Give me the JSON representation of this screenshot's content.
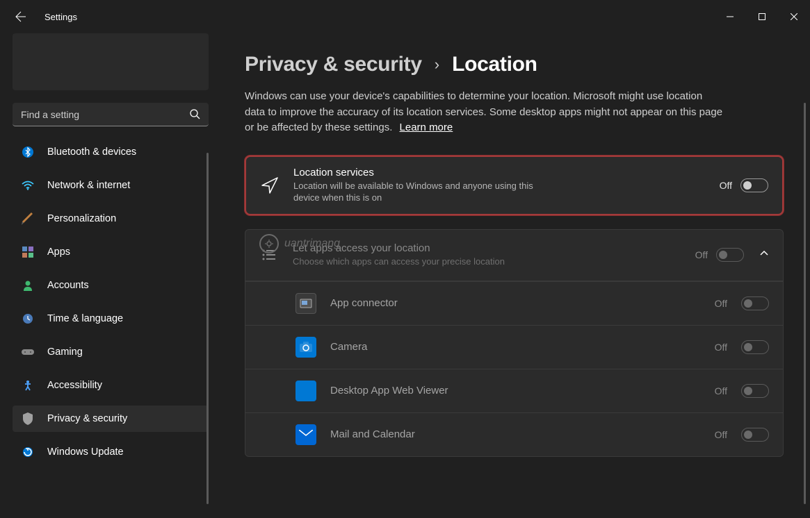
{
  "app_title": "Settings",
  "search": {
    "placeholder": "Find a setting"
  },
  "sidebar": {
    "items": [
      {
        "label": "Bluetooth & devices"
      },
      {
        "label": "Network & internet"
      },
      {
        "label": "Personalization"
      },
      {
        "label": "Apps"
      },
      {
        "label": "Accounts"
      },
      {
        "label": "Time & language"
      },
      {
        "label": "Gaming"
      },
      {
        "label": "Accessibility"
      },
      {
        "label": "Privacy & security"
      },
      {
        "label": "Windows Update"
      }
    ]
  },
  "breadcrumb": {
    "parent": "Privacy & security",
    "current": "Location"
  },
  "description": "Windows can use your device's capabilities to determine your location. Microsoft might use location data to improve the accuracy of its location services. Some desktop apps might not appear on this page or be affected by these settings.",
  "learn_more": "Learn more",
  "location_services": {
    "title": "Location services",
    "sub": "Location will be available to Windows and anyone using this device when this is on",
    "state": "Off"
  },
  "app_access": {
    "title": "Let apps access your location",
    "sub": "Choose which apps can access your precise location",
    "state": "Off"
  },
  "apps": [
    {
      "name": "App connector",
      "state": "Off",
      "icon": "app-connector"
    },
    {
      "name": "Camera",
      "state": "Off",
      "icon": "camera"
    },
    {
      "name": "Desktop App Web Viewer",
      "state": "Off",
      "icon": "desktop-viewer"
    },
    {
      "name": "Mail and Calendar",
      "state": "Off",
      "icon": "mail"
    }
  ],
  "watermark": "uantrimang"
}
